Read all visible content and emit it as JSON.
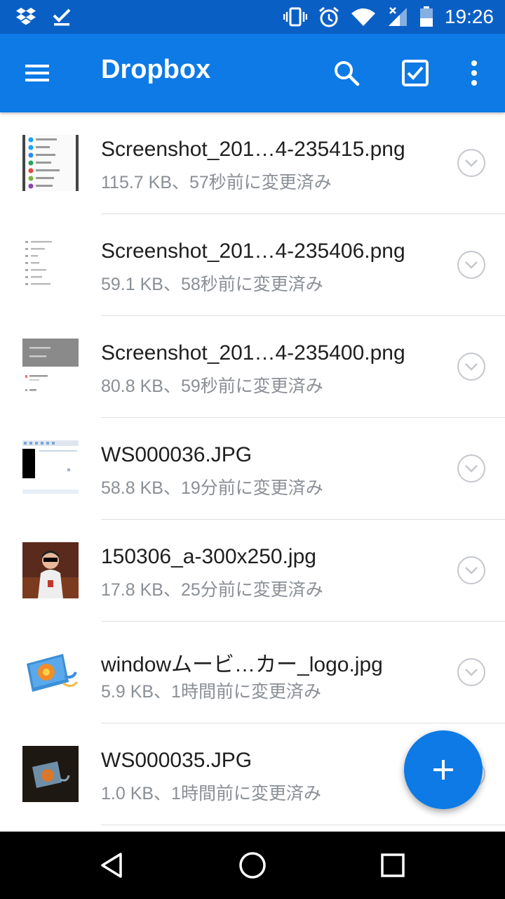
{
  "status_bar": {
    "time": "19:26",
    "left_icons": [
      "dropbox-icon",
      "check-icon"
    ],
    "right_icons": [
      "vibrate-icon",
      "alarm-icon",
      "wifi-icon",
      "signal-icon",
      "battery-icon"
    ]
  },
  "app_bar": {
    "title": "Dropbox",
    "color": "#0d7ae5",
    "actions": [
      "search-icon",
      "select-icon",
      "more-icon"
    ]
  },
  "files": [
    {
      "name": "Screenshot_201…4-235415.png",
      "meta": "115.7 KB、57秒前に変更済み"
    },
    {
      "name": "Screenshot_201…4-235406.png",
      "meta": "59.1 KB、58秒前に変更済み"
    },
    {
      "name": "Screenshot_201…4-235400.png",
      "meta": "80.8 KB、59秒前に変更済み"
    },
    {
      "name": "WS000036.JPG",
      "meta": "58.8 KB、19分前に変更済み"
    },
    {
      "name": "150306_a-300x250.jpg",
      "meta": "17.8 KB、25分前に変更済み"
    },
    {
      "name": "windowムービ…カー_logo.jpg",
      "meta": "5.9 KB、1時間前に変更済み"
    },
    {
      "name": "WS000035.JPG",
      "meta": "1.0 KB、1時間前に変更済み"
    }
  ],
  "fab": {
    "icon": "plus-icon"
  },
  "nav_bar": {
    "buttons": [
      "back-icon",
      "home-icon",
      "recents-icon"
    ]
  }
}
